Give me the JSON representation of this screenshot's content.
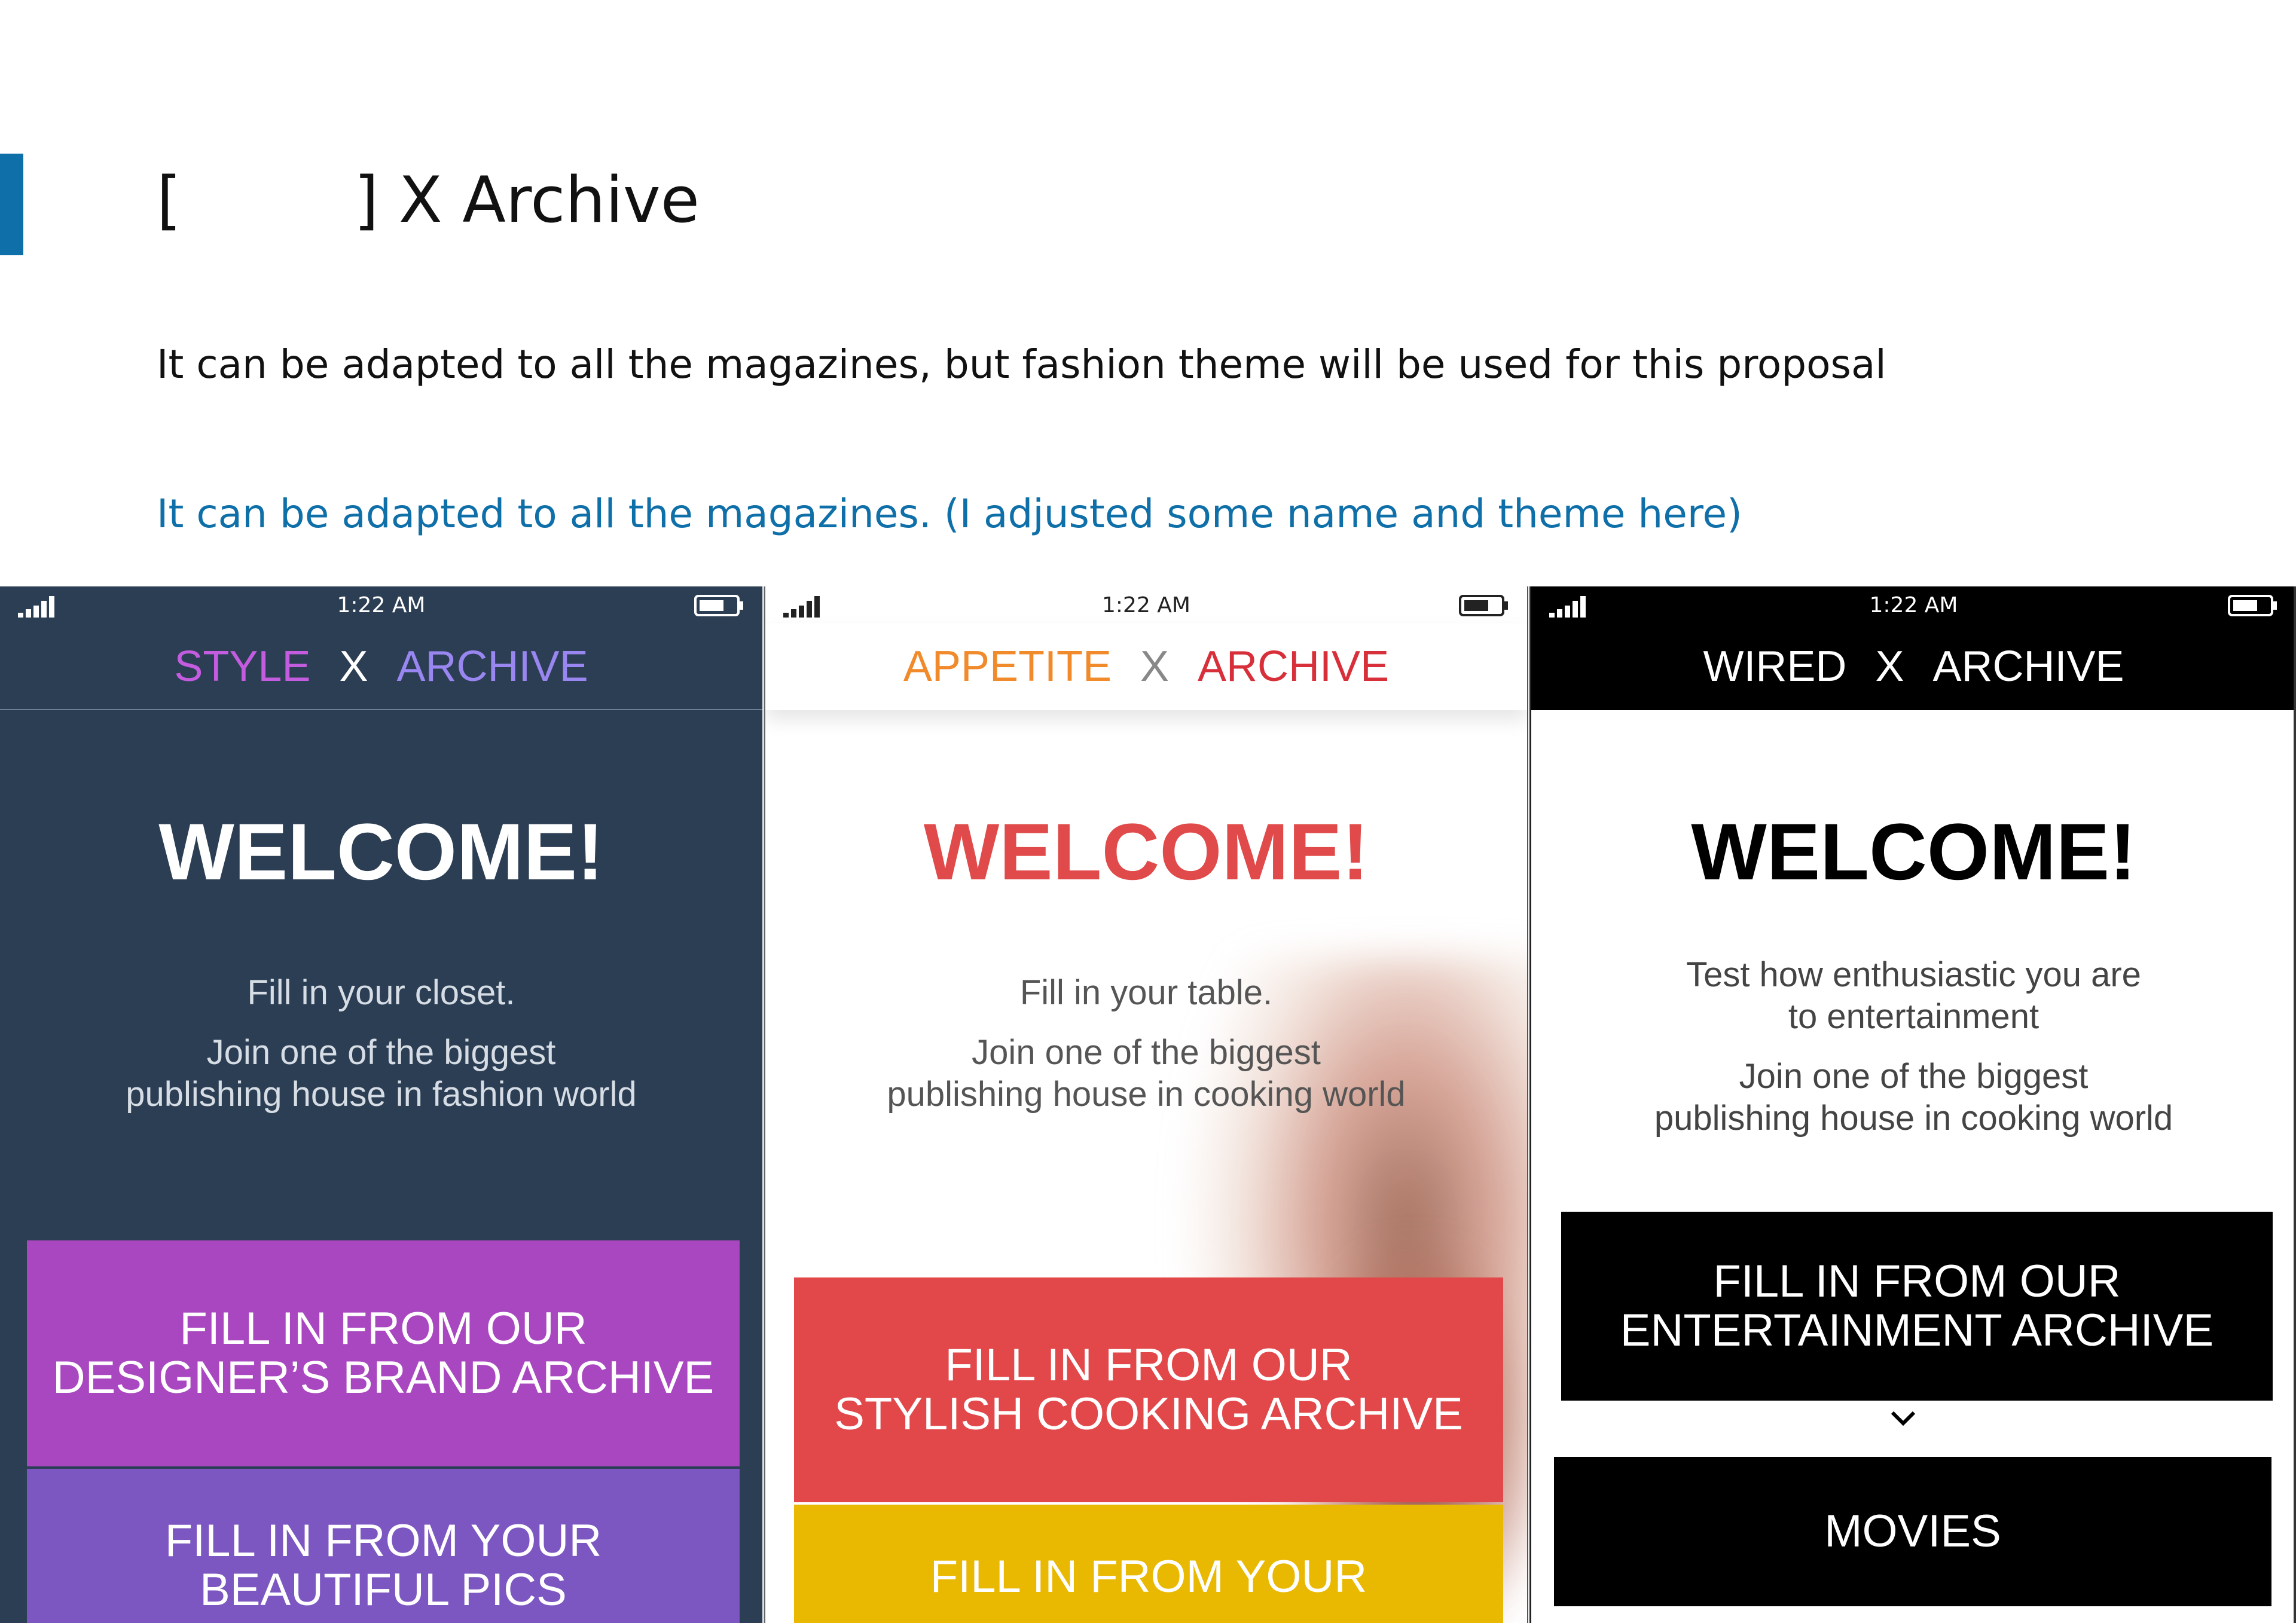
{
  "page": {
    "title_open": "[",
    "title_close": "] X Archive",
    "subtitle": "It can be adapted to all the magazines, but fashion theme will be used for this proposal",
    "note": "It can be adapted to all the magazines. (I adjusted some name and theme here)",
    "accent_color": "#0f6fa8"
  },
  "phones": [
    {
      "time": "1:22 AM",
      "brand": "STYLE",
      "x": "X",
      "archive": "ARCHIVE",
      "brand_color": "#c45ce0",
      "archive_color": "#9a86f0",
      "welcome": "WELCOME!",
      "lines": [
        "Fill in your closet.",
        "Join one of the biggest",
        "publishing house in fashion world"
      ],
      "buttons": [
        {
          "label": "FILL IN FROM OUR\nDESIGNER’S BRAND ARCHIVE",
          "color": "#a847bf"
        },
        {
          "label": "FILL IN FROM YOUR\nBEAUTIFUL PICS",
          "color": "#7c56c1"
        }
      ]
    },
    {
      "time": "1:22 AM",
      "brand": "APPETITE",
      "x": "X",
      "archive": "ARCHIVE",
      "brand_color": "#f08a2a",
      "archive_color": "#d8303a",
      "welcome": "WELCOME!",
      "lines": [
        "Fill in your table.",
        "Join one of the biggest",
        "publishing house in cooking world"
      ],
      "buttons": [
        {
          "label": "FILL IN FROM OUR\nSTYLISH COOKING ARCHIVE",
          "color": "#e2474a"
        },
        {
          "label": "FILL IN FROM YOUR",
          "color": "#e9b800"
        }
      ]
    },
    {
      "time": "1:22 AM",
      "brand": "WIRED",
      "x": "X",
      "archive": "ARCHIVE",
      "brand_color": "#ffffff",
      "archive_color": "#ffffff",
      "welcome": "WELCOME!",
      "lines": [
        "Test how enthusiastic you are",
        "to entertainment",
        "Join one of the biggest",
        "publishing house in cooking world"
      ],
      "buttons": [
        {
          "label": "FILL IN FROM OUR\nENTERTAINMENT ARCHIVE",
          "color": "#000000"
        },
        {
          "label": "MOVIES",
          "color": "#000000"
        }
      ],
      "chevron_icon": "chevron-down-icon"
    }
  ]
}
